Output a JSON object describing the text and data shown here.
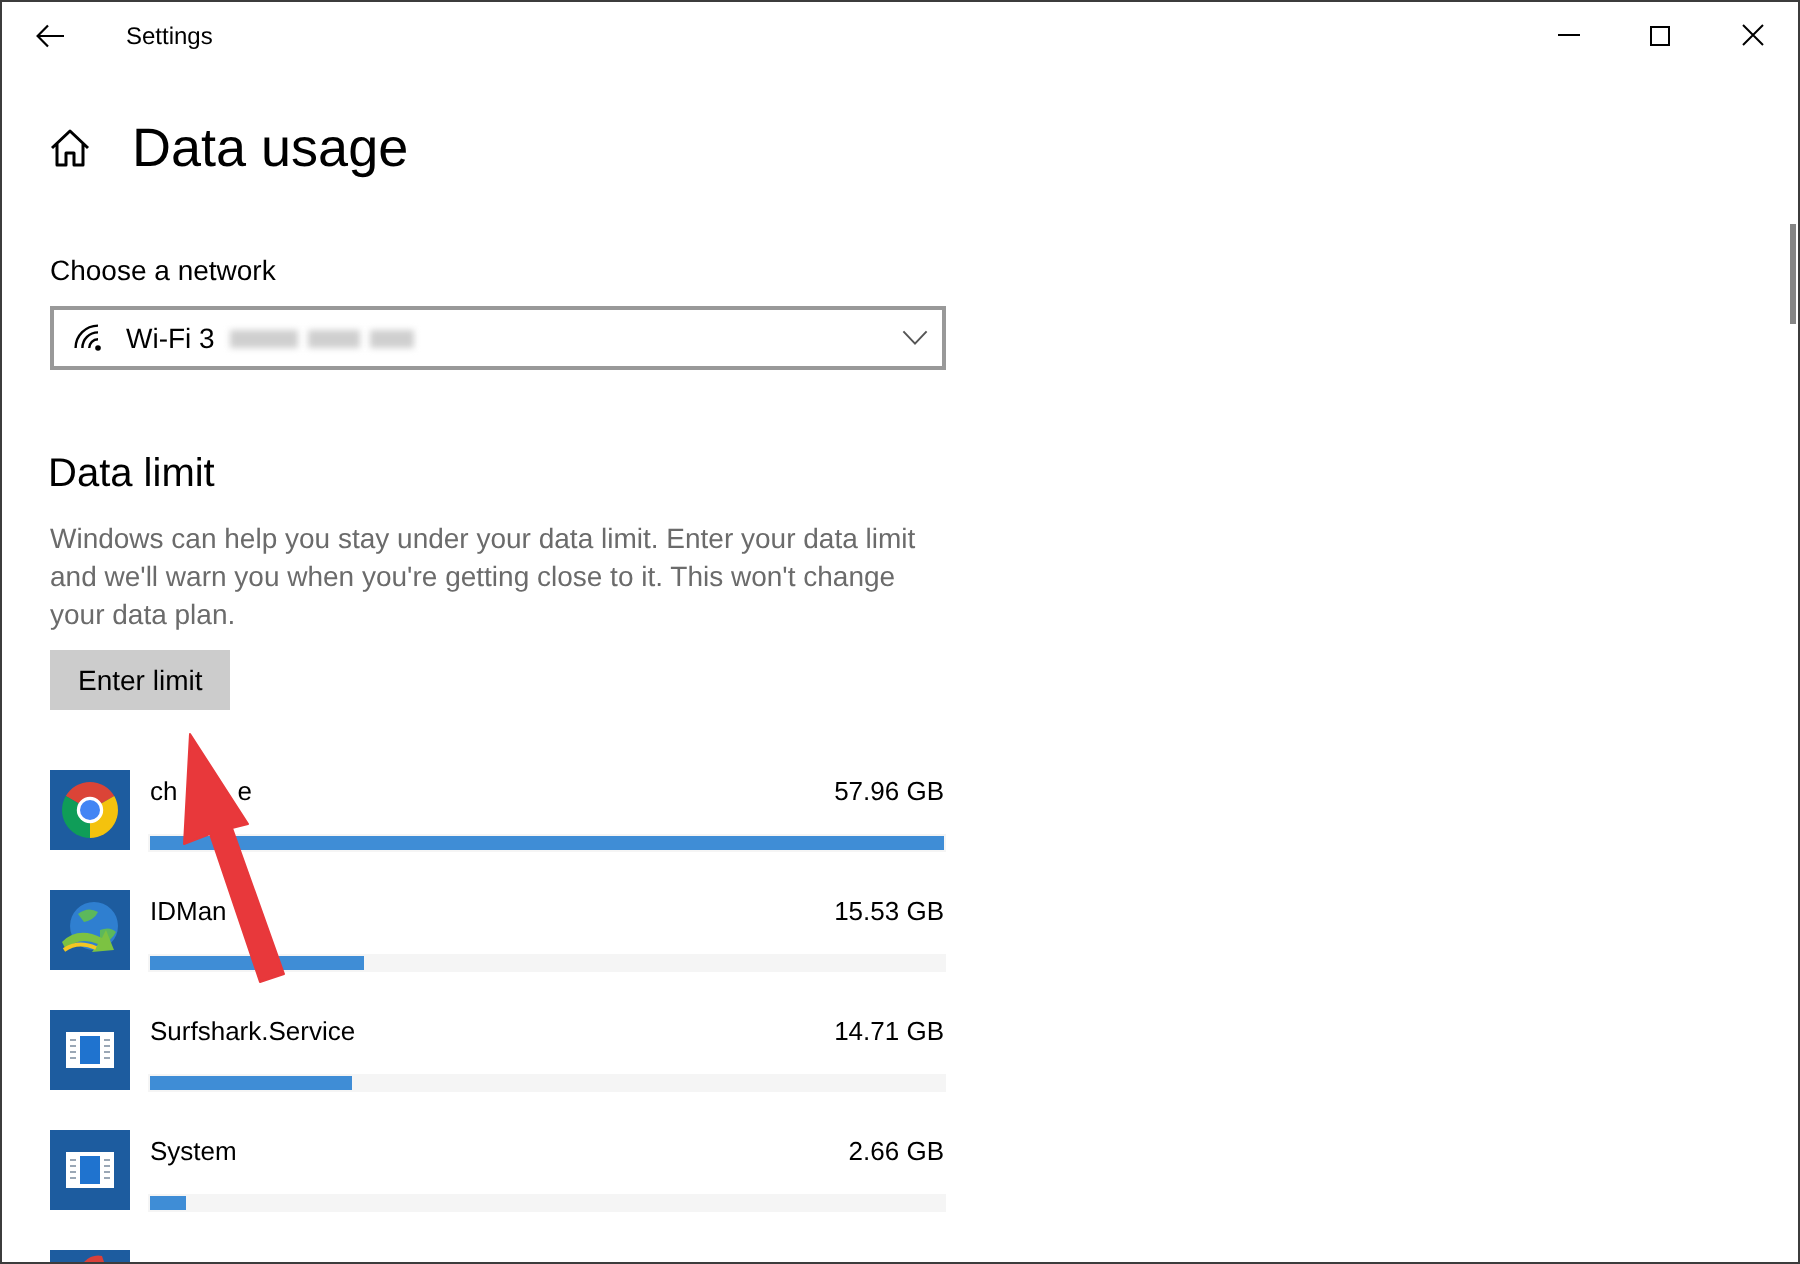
{
  "window": {
    "title": "Settings"
  },
  "page": {
    "title": "Data usage"
  },
  "network": {
    "label": "Choose a network",
    "value": "Wi-Fi 3",
    "redacted": true
  },
  "data_limit": {
    "heading": "Data limit",
    "description": "Windows can help you stay under your data limit. Enter your data limit and we'll warn you when you're getting close to it. This won't change your data plan.",
    "button": "Enter limit"
  },
  "apps": [
    {
      "kind": "browser",
      "name": [
        "ch",
        "e"
      ],
      "usage": "57.96 GB",
      "level": 1
    },
    {
      "kind": "downloader",
      "name": [
        "IDMan"
      ],
      "usage": "15.53 GB",
      "level": 0.27
    },
    {
      "kind": "window",
      "name": [
        "Surfshark.Service"
      ],
      "usage": "14.71 GB",
      "level": 0.254
    },
    {
      "kind": "window",
      "name": [
        "System"
      ],
      "usage": "2.66 GB",
      "level": 0.046
    },
    {
      "kind": "cut_off"
    }
  ],
  "annotation": {
    "kind": "arrow"
  }
}
